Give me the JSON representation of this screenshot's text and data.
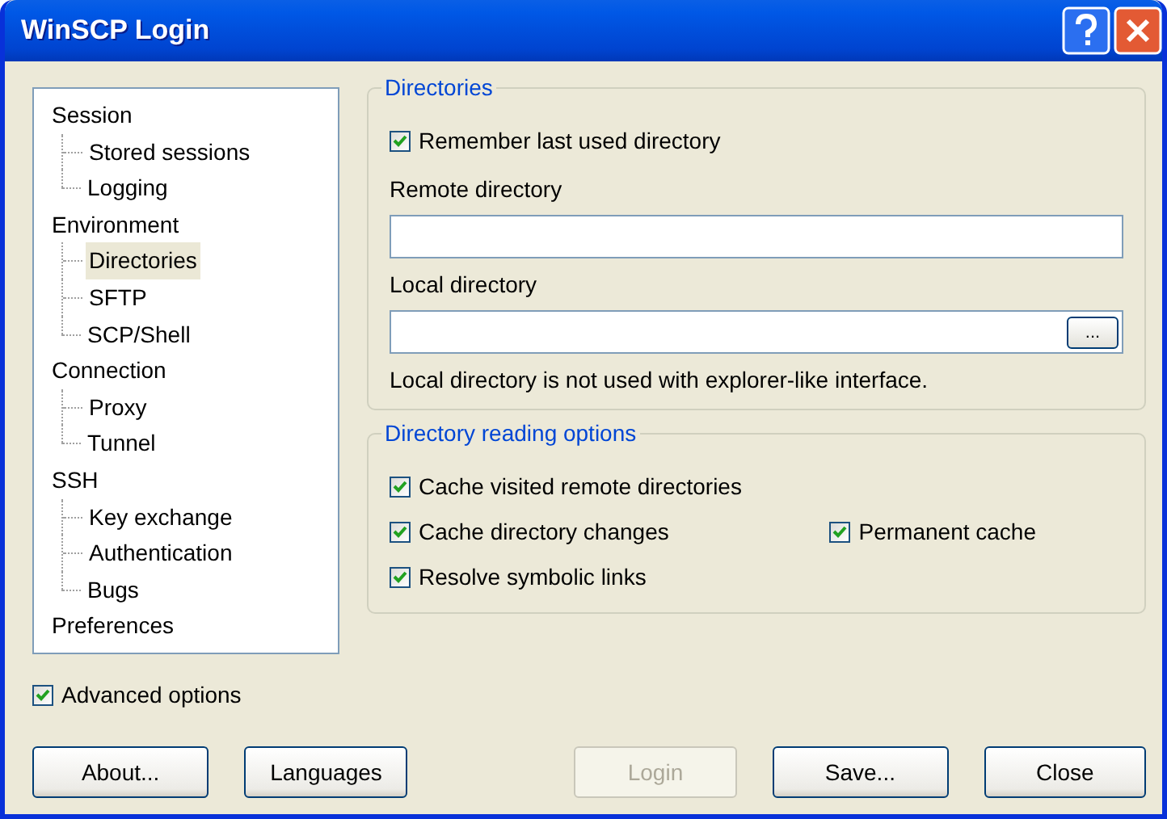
{
  "window": {
    "title": "WinSCP Login"
  },
  "tree": [
    {
      "label": "Session",
      "selected": false,
      "children": [
        {
          "label": "Stored sessions",
          "selected": false
        },
        {
          "label": "Logging",
          "selected": false
        }
      ]
    },
    {
      "label": "Environment",
      "selected": false,
      "children": [
        {
          "label": "Directories",
          "selected": true
        },
        {
          "label": "SFTP",
          "selected": false
        },
        {
          "label": "SCP/Shell",
          "selected": false
        }
      ]
    },
    {
      "label": "Connection",
      "selected": false,
      "children": [
        {
          "label": "Proxy",
          "selected": false
        },
        {
          "label": "Tunnel",
          "selected": false
        }
      ]
    },
    {
      "label": "SSH",
      "selected": false,
      "children": [
        {
          "label": "Key exchange",
          "selected": false
        },
        {
          "label": "Authentication",
          "selected": false
        },
        {
          "label": "Bugs",
          "selected": false
        }
      ]
    },
    {
      "label": "Preferences",
      "selected": false
    }
  ],
  "groups": [
    {
      "title": "Directories",
      "rows": [
        [
          {
            "kind": "checkbox",
            "label": "Remember last used directory",
            "checked": true
          }
        ],
        [
          {
            "kind": "label",
            "label": "Remote directory"
          }
        ],
        [
          {
            "kind": "field"
          }
        ],
        [
          {
            "kind": "label",
            "label": "Local directory"
          }
        ],
        [
          {
            "kind": "field",
            "button": "..."
          }
        ],
        [
          {
            "kind": "note",
            "label": "Local directory is not used with explorer-like interface."
          }
        ]
      ]
    },
    {
      "title": "Directory reading options",
      "rows": [
        [
          {
            "kind": "checkbox",
            "label": "Cache visited remote directories",
            "checked": true
          }
        ],
        [
          {
            "kind": "checkbox",
            "label": "Cache directory changes",
            "checked": true
          },
          {
            "kind": "checkbox",
            "label": "Permanent cache",
            "checked": true
          }
        ],
        [
          {
            "kind": "checkbox",
            "label": "Resolve symbolic links",
            "checked": true
          }
        ]
      ]
    }
  ],
  "advanced": {
    "label": "Advanced options",
    "checked": true
  },
  "buttons": [
    {
      "label": "About...",
      "disabled": false
    },
    {
      "label": "Languages",
      "disabled": false
    },
    {
      "label": "Login",
      "disabled": true
    },
    {
      "label": "Save...",
      "disabled": false
    },
    {
      "label": "Close",
      "disabled": false
    }
  ]
}
